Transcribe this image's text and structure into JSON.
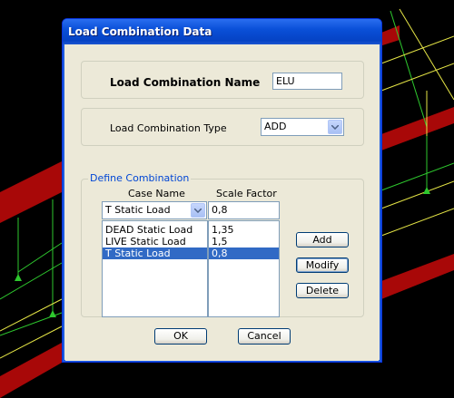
{
  "window": {
    "title": "Load Combination Data"
  },
  "name_section": {
    "label": "Load Combination Name",
    "value": "ELU"
  },
  "type_section": {
    "label": "Load Combination Type",
    "selected": "ADD"
  },
  "define": {
    "legend": "Define Combination",
    "case_header": "Case Name",
    "scale_header": "Scale Factor",
    "case_selected": "T Static Load",
    "scale_value": "0,8",
    "cases": [
      {
        "name": "DEAD Static Load",
        "factor": "1,35",
        "selected": false
      },
      {
        "name": "LIVE Static Load",
        "factor": "1,5",
        "selected": false
      },
      {
        "name": "T Static Load",
        "factor": "0,8",
        "selected": true
      }
    ]
  },
  "buttons": {
    "add": "Add",
    "modify": "Modify",
    "delete": "Delete",
    "ok": "OK",
    "cancel": "Cancel"
  },
  "colors": {
    "frame_green": "#2ec82e",
    "frame_yellow": "#e6e646",
    "beam_red": "#b40a0a"
  }
}
